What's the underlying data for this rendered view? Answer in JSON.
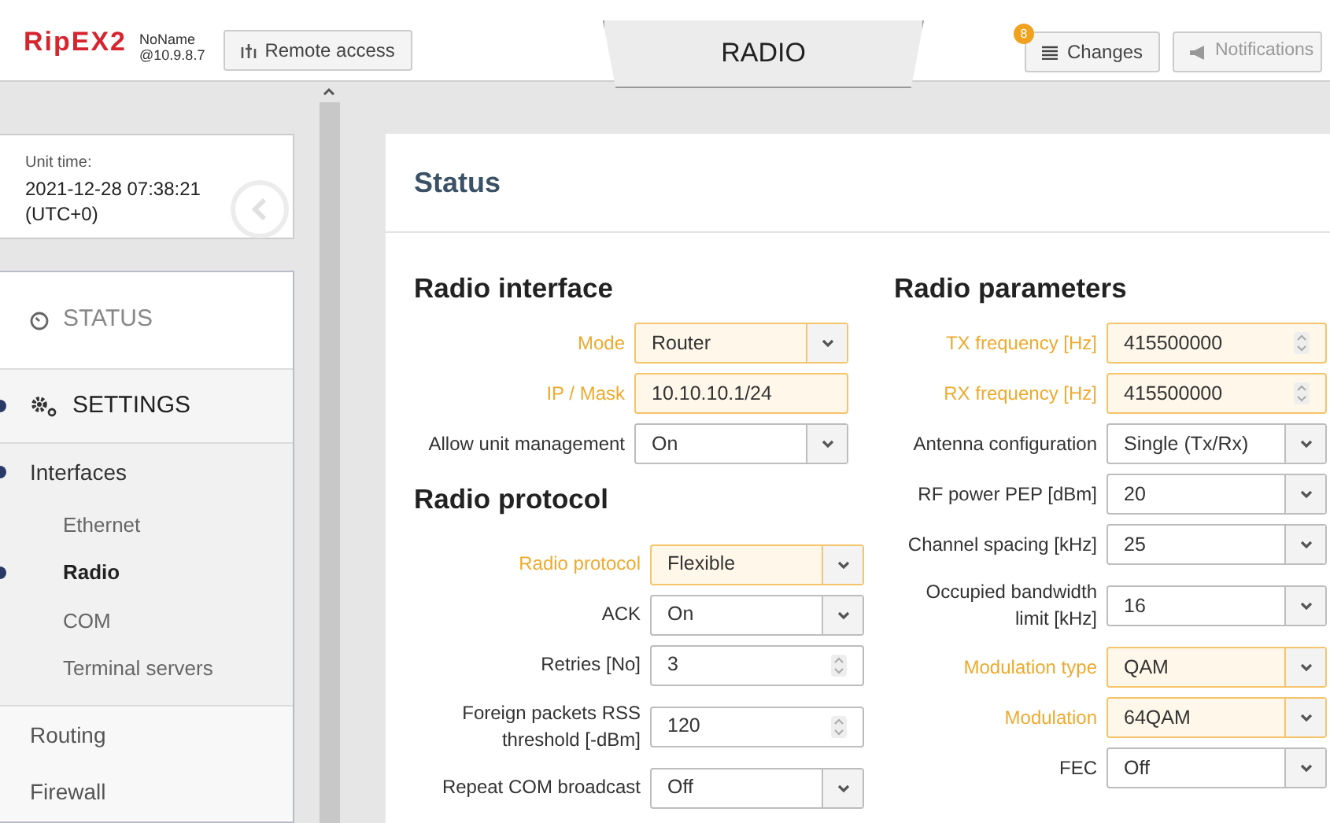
{
  "header": {
    "logo": "RipEX2",
    "unit_name": "NoName",
    "unit_address": "@10.9.8.7",
    "remote_access": "Remote access",
    "page_tab": "RADIO",
    "changes": {
      "label": "Changes",
      "count": "8"
    },
    "notifications": {
      "label": "Notifications",
      "disabled": true
    }
  },
  "unit_time": {
    "label": "Unit time:",
    "value": "2021-12-28 07:38:21",
    "zone": "(UTC+0)"
  },
  "nav": [
    {
      "label": "STATUS",
      "kind": "status",
      "selected": false
    },
    {
      "label": "SETTINGS",
      "kind": "settings",
      "selected": true,
      "children": [
        {
          "label": "Interfaces",
          "selected": true,
          "children": [
            {
              "label": "Ethernet",
              "selected": false
            },
            {
              "label": "Radio",
              "selected": true
            },
            {
              "label": "COM",
              "selected": false
            },
            {
              "label": "Terminal servers",
              "selected": false
            }
          ]
        },
        {
          "label": "Routing",
          "selected": false
        },
        {
          "label": "Firewall",
          "selected": false
        }
      ]
    }
  ],
  "panel_title": "Status",
  "columns": [
    {
      "sections": [
        {
          "title": "Radio interface",
          "fields": [
            {
              "label": "Mode",
              "kind": "select",
              "value": "Router",
              "modified": true
            },
            {
              "label": "IP / Mask",
              "kind": "text",
              "value": "10.10.10.1/24",
              "modified": true
            },
            {
              "label": "Allow unit management",
              "kind": "select",
              "value": "On",
              "modified": false
            }
          ]
        },
        {
          "title": "Radio protocol",
          "fields": [
            {
              "label": "Radio protocol",
              "kind": "select",
              "value": "Flexible",
              "modified": true
            },
            {
              "label": "ACK",
              "kind": "select",
              "value": "On",
              "modified": false
            },
            {
              "label": "Retries [No]",
              "kind": "number",
              "value": "3",
              "modified": false
            },
            {
              "label": "Foreign packets RSS threshold [-dBm]",
              "kind": "number",
              "value": "120",
              "modified": false
            },
            {
              "label": "Repeat COM broadcast",
              "kind": "select",
              "value": "Off",
              "modified": false
            }
          ]
        }
      ]
    },
    {
      "sections": [
        {
          "title": "Radio parameters",
          "fields": [
            {
              "label": "TX frequency [Hz]",
              "kind": "number",
              "value": "415500000",
              "modified": true
            },
            {
              "label": "RX frequency [Hz]",
              "kind": "number",
              "value": "415500000",
              "modified": true
            },
            {
              "label": "Antenna configuration",
              "kind": "select",
              "value": "Single (Tx/Rx)",
              "modified": false
            },
            {
              "label": "RF power PEP [dBm]",
              "kind": "select",
              "value": "20",
              "modified": false
            },
            {
              "label": "Channel spacing [kHz]",
              "kind": "select",
              "value": "25",
              "modified": false
            },
            {
              "label": "Occupied bandwidth limit [kHz]",
              "kind": "select",
              "value": "16",
              "modified": false
            },
            {
              "label": "Modulation type",
              "kind": "select",
              "value": "QAM",
              "modified": true
            },
            {
              "label": "Modulation",
              "kind": "select",
              "value": "64QAM",
              "modified": true
            },
            {
              "label": "FEC",
              "kind": "select",
              "value": "Off",
              "modified": false
            }
          ]
        }
      ]
    }
  ]
}
